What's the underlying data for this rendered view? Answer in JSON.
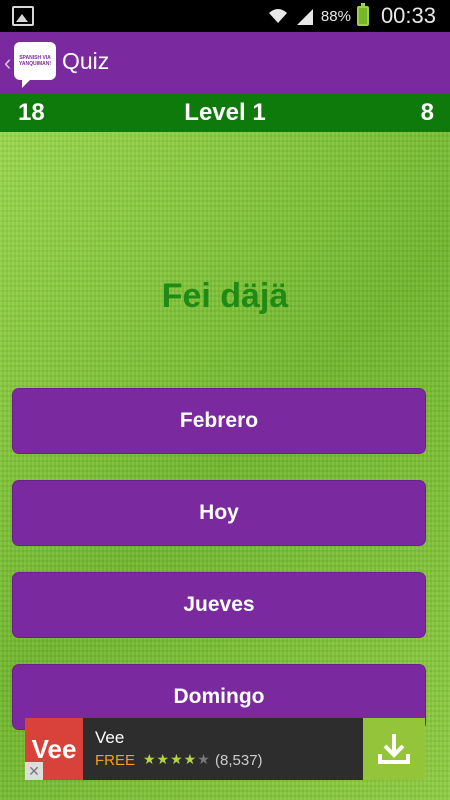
{
  "status_bar": {
    "battery_pct": "88%",
    "time": "00:33"
  },
  "app_bar": {
    "title": "Quiz",
    "logo_text": "SPANISH VIA YANQUIMAN!"
  },
  "score_bar": {
    "left_score": "18",
    "level": "Level 1",
    "right_score": "8"
  },
  "question": {
    "word": "Fei däjä"
  },
  "answers": [
    {
      "label": "Febrero"
    },
    {
      "label": "Hoy"
    },
    {
      "label": "Jueves"
    },
    {
      "label": "Domingo"
    }
  ],
  "ad": {
    "logo": "Vee",
    "app_name": "Vee",
    "price": "FREE",
    "stars_filled": "★★★★",
    "stars_empty": "★",
    "rating_count": "(8,537)"
  },
  "colors": {
    "purple": "#7a2a9e",
    "green_bar": "#0f7a0c",
    "word": "#1f8a14"
  }
}
